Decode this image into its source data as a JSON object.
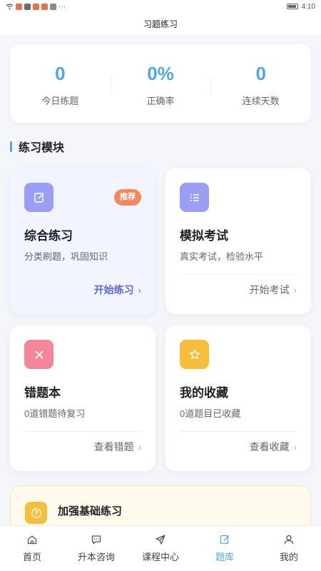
{
  "status_bar": {
    "time": "4:10",
    "dots": "···"
  },
  "header": {
    "title": "习题练习"
  },
  "stats": [
    {
      "value": "0",
      "label": "今日练题"
    },
    {
      "value": "0%",
      "label": "正确率"
    },
    {
      "value": "0",
      "label": "连续天数"
    }
  ],
  "section": {
    "title": "练习模块"
  },
  "modules": [
    {
      "title": "综合练习",
      "desc": "分类刷题，巩固知识",
      "action": "开始练习",
      "badge": "推荐",
      "icon": "edit-icon",
      "icon_color": "#9b9ef5"
    },
    {
      "title": "模拟考试",
      "desc": "真实考试，检验水平",
      "action": "开始考试",
      "icon": "list-icon",
      "icon_color": "#9b9ef5"
    },
    {
      "title": "错题本",
      "desc": "0道错题待复习",
      "action": "查看错题",
      "icon": "close-icon",
      "icon_color": "#f5869a"
    },
    {
      "title": "我的收藏",
      "desc": "0道题目已收藏",
      "action": "查看收藏",
      "icon": "star-icon",
      "icon_color": "#f6be3a"
    }
  ],
  "tip": {
    "title": "加强基础练习",
    "icon": "question-icon"
  },
  "tabs": [
    {
      "label": "首页",
      "icon": "home-icon"
    },
    {
      "label": "升本咨询",
      "icon": "chat-icon"
    },
    {
      "label": "课程中心",
      "icon": "send-icon"
    },
    {
      "label": "题库",
      "icon": "question-bank-icon"
    },
    {
      "label": "我的",
      "icon": "user-icon"
    }
  ],
  "colors": {
    "accent": "#4fa6ea",
    "primary_action": "#5b67d6",
    "badge": "#f08a5d"
  }
}
